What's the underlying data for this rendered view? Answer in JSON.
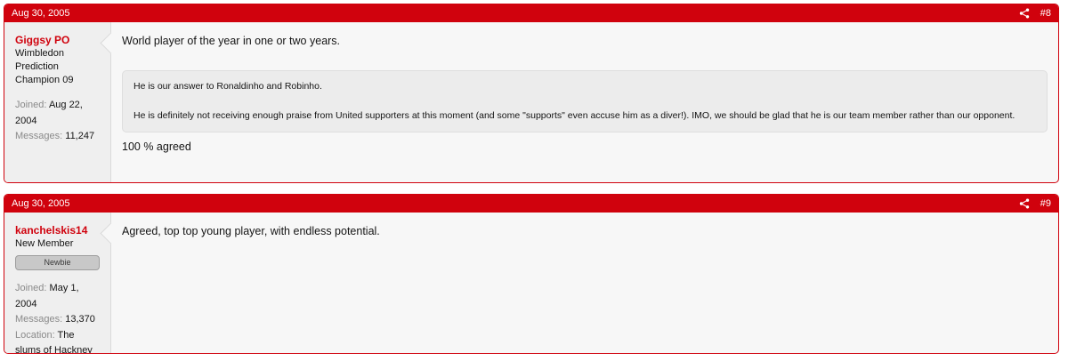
{
  "posts": [
    {
      "date": "Aug 30, 2005",
      "number": "#8",
      "icon": "share-icon",
      "user": {
        "name": "Giggsy PO",
        "title_lines": [
          "Wimbledon",
          "Prediction",
          "Champion 09"
        ],
        "extras": [
          {
            "key": "Joined:",
            "value": "Aug 22, 2004"
          },
          {
            "key": "Messages:",
            "value": "11,247"
          }
        ]
      },
      "message": {
        "text": "World player of the year in one or two years.",
        "quote": [
          "He is our answer to Ronaldinho and Robinho.",
          "He is definitely not receiving enough praise from United supporters at this moment (and some \"supports\" even accuse him as a diver!). IMO, we should be glad that he is our team member rather than our opponent."
        ],
        "after_quote": "100 % agreed"
      }
    },
    {
      "date": "Aug 30, 2005",
      "number": "#9",
      "icon": "share-icon",
      "user": {
        "name": "kanchelskis14",
        "title": "New Member",
        "banner": "Newbie",
        "extras": [
          {
            "key": "Joined:",
            "value": "May 1, 2004"
          },
          {
            "key": "Messages:",
            "value": "13,370"
          },
          {
            "key": "Location:",
            "value": "The slums of Hackney"
          }
        ]
      },
      "message": {
        "text": "Agreed, top top young player, with endless potential."
      }
    }
  ],
  "colors": {
    "accent": "#d0020d",
    "user_cell_bg": "#efefef",
    "post_bg": "#f7f7f7"
  }
}
